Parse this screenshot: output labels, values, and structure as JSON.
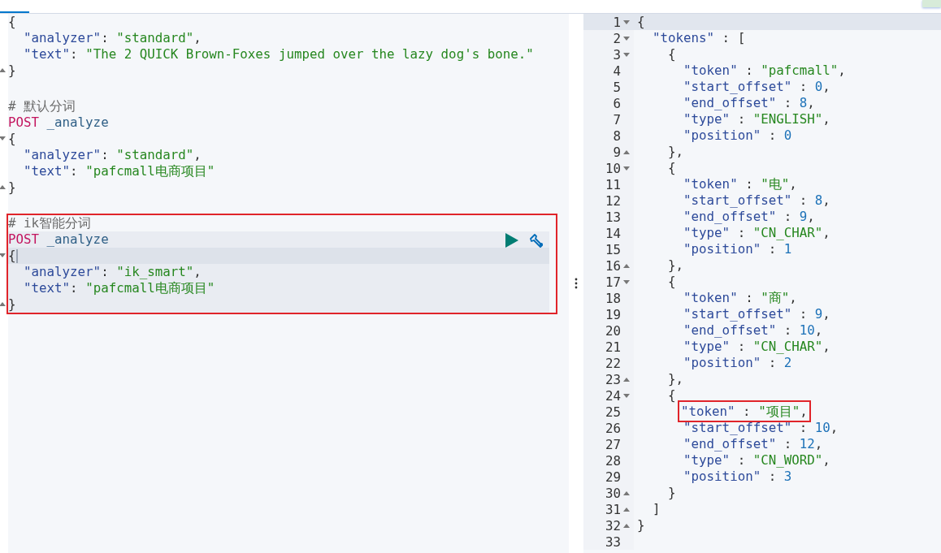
{
  "tab_bar": {
    "tabs": [
      {
        "selected": true
      }
    ]
  },
  "console": {
    "requests": [
      {
        "outlined": false,
        "selected": false,
        "lines": [
          {
            "segments": [
              {
                "kind": "punct",
                "text": "{"
              }
            ]
          },
          {
            "segments": [
              {
                "kind": "key",
                "text": "  \"analyzer\""
              },
              {
                "kind": "punct",
                "text": ": "
              },
              {
                "kind": "string",
                "text": "\"standard\""
              },
              {
                "kind": "punct",
                "text": ","
              }
            ]
          },
          {
            "segments": [
              {
                "kind": "key",
                "text": "  \"text\""
              },
              {
                "kind": "punct",
                "text": ": "
              },
              {
                "kind": "string",
                "text": "\"The 2 QUICK Brown-Foxes jumped over the lazy dog's bone.\""
              }
            ]
          },
          {
            "fold_end": true,
            "segments": [
              {
                "kind": "punct",
                "text": "}"
              }
            ]
          }
        ]
      },
      {
        "outlined": false,
        "selected": false,
        "comment": "# 默认分词",
        "lines": [
          {
            "segments": [
              {
                "kind": "method",
                "text": "POST"
              },
              {
                "kind": "path",
                "text": " _analyze"
              }
            ]
          },
          {
            "fold_start": true,
            "segments": [
              {
                "kind": "punct",
                "text": "{"
              }
            ]
          },
          {
            "segments": [
              {
                "kind": "key",
                "text": "  \"analyzer\""
              },
              {
                "kind": "punct",
                "text": ": "
              },
              {
                "kind": "string",
                "text": "\"standard\""
              },
              {
                "kind": "punct",
                "text": ","
              }
            ]
          },
          {
            "segments": [
              {
                "kind": "key",
                "text": "  \"text\""
              },
              {
                "kind": "punct",
                "text": ": "
              },
              {
                "kind": "string",
                "text": "\"pafcmall电商项目\""
              }
            ]
          },
          {
            "fold_end": true,
            "segments": [
              {
                "kind": "punct",
                "text": "}"
              }
            ]
          }
        ]
      },
      {
        "outlined": true,
        "selected": true,
        "comment": "# ik智能分词",
        "lines": [
          {
            "segments": [
              {
                "kind": "method",
                "text": "POST"
              },
              {
                "kind": "path",
                "text": " _analyze"
              }
            ]
          },
          {
            "fold_start": true,
            "active": true,
            "segments": [
              {
                "kind": "punct",
                "text": "{"
              }
            ]
          },
          {
            "segments": [
              {
                "kind": "key",
                "text": "  \"analyzer\""
              },
              {
                "kind": "punct",
                "text": ": "
              },
              {
                "kind": "string",
                "text": "\"ik_smart\""
              },
              {
                "kind": "punct",
                "text": ","
              }
            ]
          },
          {
            "segments": [
              {
                "kind": "key",
                "text": "  \"text\""
              },
              {
                "kind": "punct",
                "text": ": "
              },
              {
                "kind": "string",
                "text": "\"pafcmall电商项目\""
              }
            ]
          },
          {
            "fold_end": true,
            "segments": [
              {
                "kind": "punct",
                "text": "}"
              }
            ]
          }
        ]
      }
    ]
  },
  "output": {
    "lines": [
      {
        "number": "1",
        "fold_start": true,
        "active": true,
        "segments": [
          {
            "kind": "punct",
            "text": "{"
          }
        ]
      },
      {
        "number": "2",
        "fold_start": true,
        "segments": [
          {
            "kind": "key",
            "text": "  \"tokens\""
          },
          {
            "kind": "punct",
            "text": " : ["
          }
        ]
      },
      {
        "number": "3",
        "fold_start": true,
        "segments": [
          {
            "kind": "punct",
            "text": "    {"
          }
        ]
      },
      {
        "number": "4",
        "segments": [
          {
            "kind": "key",
            "text": "      \"token\""
          },
          {
            "kind": "punct",
            "text": " : "
          },
          {
            "kind": "string",
            "text": "\"pafcmall\""
          },
          {
            "kind": "punct",
            "text": ","
          }
        ]
      },
      {
        "number": "5",
        "segments": [
          {
            "kind": "key",
            "text": "      \"start_offset\""
          },
          {
            "kind": "punct",
            "text": " : "
          },
          {
            "kind": "number",
            "text": "0"
          },
          {
            "kind": "punct",
            "text": ","
          }
        ]
      },
      {
        "number": "6",
        "segments": [
          {
            "kind": "key",
            "text": "      \"end_offset\""
          },
          {
            "kind": "punct",
            "text": " : "
          },
          {
            "kind": "number",
            "text": "8"
          },
          {
            "kind": "punct",
            "text": ","
          }
        ]
      },
      {
        "number": "7",
        "segments": [
          {
            "kind": "key",
            "text": "      \"type\""
          },
          {
            "kind": "punct",
            "text": " : "
          },
          {
            "kind": "string",
            "text": "\"ENGLISH\""
          },
          {
            "kind": "punct",
            "text": ","
          }
        ]
      },
      {
        "number": "8",
        "segments": [
          {
            "kind": "key",
            "text": "      \"position\""
          },
          {
            "kind": "punct",
            "text": " : "
          },
          {
            "kind": "number",
            "text": "0"
          }
        ]
      },
      {
        "number": "9",
        "fold_end": true,
        "segments": [
          {
            "kind": "punct",
            "text": "    },"
          }
        ]
      },
      {
        "number": "10",
        "fold_start": true,
        "segments": [
          {
            "kind": "punct",
            "text": "    {"
          }
        ]
      },
      {
        "number": "11",
        "segments": [
          {
            "kind": "key",
            "text": "      \"token\""
          },
          {
            "kind": "punct",
            "text": " : "
          },
          {
            "kind": "string",
            "text": "\"电\""
          },
          {
            "kind": "punct",
            "text": ","
          }
        ]
      },
      {
        "number": "12",
        "segments": [
          {
            "kind": "key",
            "text": "      \"start_offset\""
          },
          {
            "kind": "punct",
            "text": " : "
          },
          {
            "kind": "number",
            "text": "8"
          },
          {
            "kind": "punct",
            "text": ","
          }
        ]
      },
      {
        "number": "13",
        "segments": [
          {
            "kind": "key",
            "text": "      \"end_offset\""
          },
          {
            "kind": "punct",
            "text": " : "
          },
          {
            "kind": "number",
            "text": "9"
          },
          {
            "kind": "punct",
            "text": ","
          }
        ]
      },
      {
        "number": "14",
        "segments": [
          {
            "kind": "key",
            "text": "      \"type\""
          },
          {
            "kind": "punct",
            "text": " : "
          },
          {
            "kind": "string",
            "text": "\"CN_CHAR\""
          },
          {
            "kind": "punct",
            "text": ","
          }
        ]
      },
      {
        "number": "15",
        "segments": [
          {
            "kind": "key",
            "text": "      \"position\""
          },
          {
            "kind": "punct",
            "text": " : "
          },
          {
            "kind": "number",
            "text": "1"
          }
        ]
      },
      {
        "number": "16",
        "fold_end": true,
        "segments": [
          {
            "kind": "punct",
            "text": "    },"
          }
        ]
      },
      {
        "number": "17",
        "fold_start": true,
        "segments": [
          {
            "kind": "punct",
            "text": "    {"
          }
        ]
      },
      {
        "number": "18",
        "segments": [
          {
            "kind": "key",
            "text": "      \"token\""
          },
          {
            "kind": "punct",
            "text": " : "
          },
          {
            "kind": "string",
            "text": "\"商\""
          },
          {
            "kind": "punct",
            "text": ","
          }
        ]
      },
      {
        "number": "19",
        "segments": [
          {
            "kind": "key",
            "text": "      \"start_offset\""
          },
          {
            "kind": "punct",
            "text": " : "
          },
          {
            "kind": "number",
            "text": "9"
          },
          {
            "kind": "punct",
            "text": ","
          }
        ]
      },
      {
        "number": "20",
        "segments": [
          {
            "kind": "key",
            "text": "      \"end_offset\""
          },
          {
            "kind": "punct",
            "text": " : "
          },
          {
            "kind": "number",
            "text": "10"
          },
          {
            "kind": "punct",
            "text": ","
          }
        ]
      },
      {
        "number": "21",
        "segments": [
          {
            "kind": "key",
            "text": "      \"type\""
          },
          {
            "kind": "punct",
            "text": " : "
          },
          {
            "kind": "string",
            "text": "\"CN_CHAR\""
          },
          {
            "kind": "punct",
            "text": ","
          }
        ]
      },
      {
        "number": "22",
        "segments": [
          {
            "kind": "key",
            "text": "      \"position\""
          },
          {
            "kind": "punct",
            "text": " : "
          },
          {
            "kind": "number",
            "text": "2"
          }
        ]
      },
      {
        "number": "23",
        "fold_end": true,
        "segments": [
          {
            "kind": "punct",
            "text": "    },"
          }
        ]
      },
      {
        "number": "24",
        "fold_start": true,
        "segments": [
          {
            "kind": "punct",
            "text": "    {"
          }
        ]
      },
      {
        "number": "25",
        "boxed": true,
        "segments": [
          {
            "kind": "key",
            "text": "\"token\""
          },
          {
            "kind": "punct",
            "text": " : "
          },
          {
            "kind": "string",
            "text": "\"项目\""
          },
          {
            "kind": "punct",
            "text": ","
          }
        ]
      },
      {
        "number": "26",
        "segments": [
          {
            "kind": "key",
            "text": "      \"start_offset\""
          },
          {
            "kind": "punct",
            "text": " : "
          },
          {
            "kind": "number",
            "text": "10"
          },
          {
            "kind": "punct",
            "text": ","
          }
        ]
      },
      {
        "number": "27",
        "segments": [
          {
            "kind": "key",
            "text": "      \"end_offset\""
          },
          {
            "kind": "punct",
            "text": " : "
          },
          {
            "kind": "number",
            "text": "12"
          },
          {
            "kind": "punct",
            "text": ","
          }
        ]
      },
      {
        "number": "28",
        "segments": [
          {
            "kind": "key",
            "text": "      \"type\""
          },
          {
            "kind": "punct",
            "text": " : "
          },
          {
            "kind": "string",
            "text": "\"CN_WORD\""
          },
          {
            "kind": "punct",
            "text": ","
          }
        ]
      },
      {
        "number": "29",
        "segments": [
          {
            "kind": "key",
            "text": "      \"position\""
          },
          {
            "kind": "punct",
            "text": " : "
          },
          {
            "kind": "number",
            "text": "3"
          }
        ]
      },
      {
        "number": "30",
        "fold_end": true,
        "segments": [
          {
            "kind": "punct",
            "text": "    }"
          }
        ]
      },
      {
        "number": "31",
        "fold_end": true,
        "segments": [
          {
            "kind": "punct",
            "text": "  ]"
          }
        ]
      },
      {
        "number": "32",
        "fold_end": true,
        "segments": [
          {
            "kind": "punct",
            "text": "}"
          }
        ]
      },
      {
        "number": "33"
      }
    ]
  }
}
